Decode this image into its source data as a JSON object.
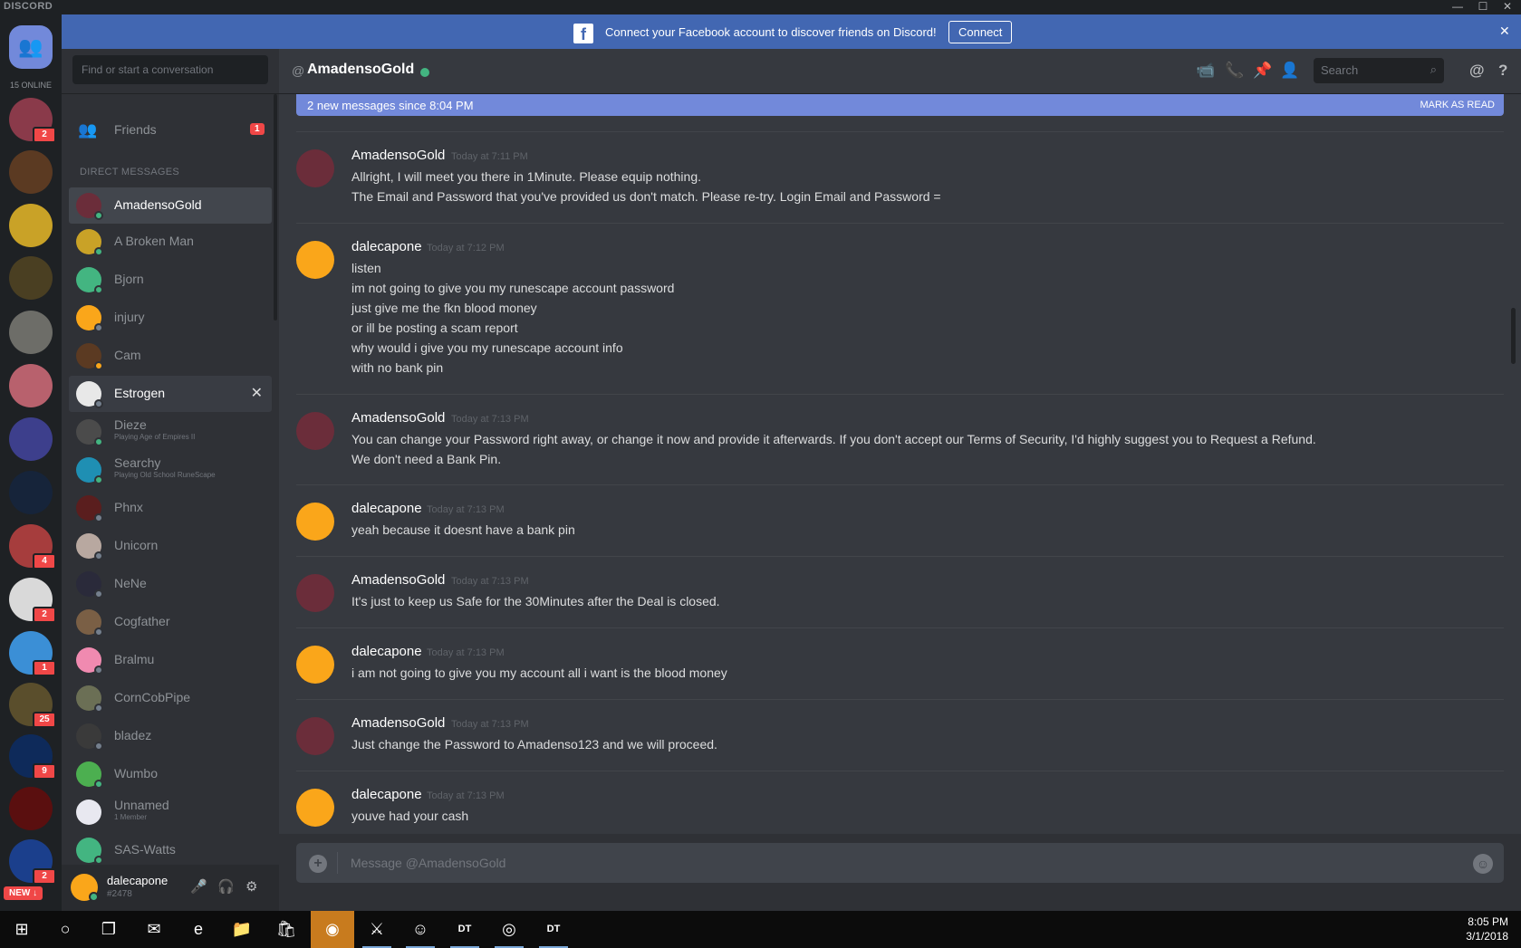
{
  "window": {
    "app_name": "DISCORD",
    "minimize": "—",
    "maximize": "☐",
    "close": "✕"
  },
  "banner": {
    "text": "Connect your Facebook account to discover friends on Discord!",
    "button": "Connect",
    "fb_glyph": "f",
    "close_glyph": "✕",
    "color": "#4267b2"
  },
  "servers": {
    "online_label": "15 ONLINE",
    "new_label": "NEW ↓",
    "items": [
      {
        "name": "friends-home",
        "color": "#7289da",
        "badge": ""
      },
      {
        "name": "server-1",
        "color": "#8a3a4a",
        "badge": "2"
      },
      {
        "name": "server-2",
        "color": "#5b3a22",
        "badge": ""
      },
      {
        "name": "server-3",
        "color": "#c9a227",
        "badge": ""
      },
      {
        "name": "server-4",
        "color": "#4a3f22",
        "badge": ""
      },
      {
        "name": "server-5",
        "color": "#6d6d68",
        "badge": ""
      },
      {
        "name": "server-6",
        "color": "#b8616d",
        "badge": ""
      },
      {
        "name": "server-7",
        "color": "#3d3f8c",
        "badge": ""
      },
      {
        "name": "server-8",
        "color": "#16243a",
        "badge": ""
      },
      {
        "name": "server-9",
        "color": "#a63d3d",
        "badge": "4"
      },
      {
        "name": "server-10",
        "color": "#d9d9d9",
        "badge": "2"
      },
      {
        "name": "server-11",
        "color": "#3b8fd6",
        "badge": "1"
      },
      {
        "name": "server-12",
        "color": "#5a4e2c",
        "badge": "25"
      },
      {
        "name": "server-13",
        "color": "#0e2a5a",
        "badge": "9"
      },
      {
        "name": "server-14",
        "color": "#5a0f0f",
        "badge": ""
      },
      {
        "name": "server-15",
        "color": "#1b3f8c",
        "badge": "2"
      }
    ]
  },
  "dm": {
    "search_placeholder": "Find or start a conversation",
    "friends_label": "Friends",
    "friends_badge": "1",
    "section_header": "DIRECT MESSAGES",
    "items": [
      {
        "name": "AmadensoGold",
        "sub": "",
        "status": "on",
        "color": "#6b2d3a"
      },
      {
        "name": "A Broken Man",
        "sub": "",
        "status": "on",
        "color": "#c9a227"
      },
      {
        "name": "Bjorn",
        "sub": "",
        "status": "on",
        "color": "#43b581"
      },
      {
        "name": "injury",
        "sub": "",
        "status": "off",
        "color": "#faa61a"
      },
      {
        "name": "Cam",
        "sub": "",
        "status": "idle",
        "color": "#5b3a22"
      },
      {
        "name": "Estrogen",
        "sub": "",
        "status": "off",
        "color": "#e8e8e8"
      },
      {
        "name": "Dieze",
        "sub": "Playing Age of Empires II",
        "status": "on",
        "color": "#4b4b4b"
      },
      {
        "name": "Searchy",
        "sub": "Playing Old School RuneScape",
        "status": "on",
        "color": "#1f8fb3"
      },
      {
        "name": "Phnx",
        "sub": "",
        "status": "off",
        "color": "#5a1e1e"
      },
      {
        "name": "Unicorn",
        "sub": "",
        "status": "off",
        "color": "#b8a8a0"
      },
      {
        "name": "NeNe",
        "sub": "",
        "status": "off",
        "color": "#2a2a3a"
      },
      {
        "name": "Cogfather",
        "sub": "",
        "status": "off",
        "color": "#7a5f45"
      },
      {
        "name": "Bralmu",
        "sub": "",
        "status": "off",
        "color": "#f08ab0"
      },
      {
        "name": "CornCobPipe",
        "sub": "",
        "status": "off",
        "color": "#6b6f55"
      },
      {
        "name": "bladez",
        "sub": "",
        "status": "off",
        "color": "#3a3a3a"
      },
      {
        "name": "Wumbo",
        "sub": "",
        "status": "on",
        "color": "#4caf50"
      },
      {
        "name": "Unnamed",
        "sub": "1 Member",
        "status": "",
        "color": "#e8e8f0"
      },
      {
        "name": "SAS-Watts",
        "sub": "",
        "status": "on",
        "color": "#43b581"
      }
    ],
    "close_glyph": "✕"
  },
  "user": {
    "name": "dalecapone",
    "tag": "#2478",
    "mic_icon": "🎤",
    "headset_icon": "🎧",
    "settings_icon": "⚙"
  },
  "channel": {
    "at": "@",
    "title": "AmadensoGold",
    "search_placeholder": "Search",
    "icons": {
      "video": "📹",
      "call": "📞",
      "pin": "📌",
      "add_friend": "👤",
      "mention": "@",
      "help": "?"
    }
  },
  "new_messages": {
    "text": "2 new messages since 8:04 PM",
    "action": "MARK AS READ"
  },
  "messages": [
    {
      "author": "AmadensoGold",
      "time": "Today at 7:11 PM",
      "lines": [
        "Allright, I will meet you there in 1Minute. Please equip nothing.",
        "The Email and Password that you've provided us don't match. Please re-try. Login Email and Password ="
      ]
    },
    {
      "author": "dalecapone",
      "time": "Today at 7:12 PM",
      "lines": [
        "listen",
        "im not going to give you my runescape account password",
        "just give me the fkn blood money",
        "or ill be posting a scam report",
        "why would i give you my runescape account info",
        "with no bank pin"
      ]
    },
    {
      "author": "AmadensoGold",
      "time": "Today at 7:13 PM",
      "lines": [
        "You can change your Password right away, or change it now and provide it afterwards. If you don't accept our Terms of Security, I'd highly suggest you to Request a Refund.",
        "We don't need a Bank Pin."
      ]
    },
    {
      "author": "dalecapone",
      "time": "Today at 7:13 PM",
      "lines": [
        "yeah because it doesnt have a bank pin"
      ]
    },
    {
      "author": "AmadensoGold",
      "time": "Today at 7:13 PM",
      "lines": [
        "It's just to keep us Safe for the 30Minutes after the Deal is closed."
      ]
    },
    {
      "author": "dalecapone",
      "time": "Today at 7:13 PM",
      "lines": [
        "i am not going to give you my account all i want is the blood money"
      ]
    },
    {
      "author": "AmadensoGold",
      "time": "Today at 7:13 PM",
      "lines": [
        "Just change the Password to Amadenso123 and we will proceed."
      ]
    },
    {
      "author": "dalecapone",
      "time": "Today at 7:13 PM",
      "lines": [
        "youve had your cash"
      ]
    }
  ],
  "composer": {
    "placeholder": "Message @AmadensoGold",
    "plus": "+",
    "emoji": "☺"
  },
  "taskbar": {
    "apps": [
      {
        "name": "start-button",
        "glyph": "⊞"
      },
      {
        "name": "search-button",
        "glyph": "○"
      },
      {
        "name": "task-view-button",
        "glyph": "❐"
      },
      {
        "name": "mail-app",
        "glyph": "✉"
      },
      {
        "name": "edge-app",
        "glyph": "e"
      },
      {
        "name": "file-explorer-app",
        "glyph": "📁"
      },
      {
        "name": "store-app",
        "glyph": "🛍"
      },
      {
        "name": "runescape-app",
        "glyph": "◉"
      },
      {
        "name": "game-app",
        "glyph": "⚔"
      },
      {
        "name": "discord-app",
        "glyph": "☺"
      },
      {
        "name": "dt-app-1",
        "glyph": "DT"
      },
      {
        "name": "chrome-app",
        "glyph": "◎"
      },
      {
        "name": "dt-app-2",
        "glyph": "DT"
      }
    ],
    "time": "8:05 PM",
    "date": "3/1/2018"
  }
}
